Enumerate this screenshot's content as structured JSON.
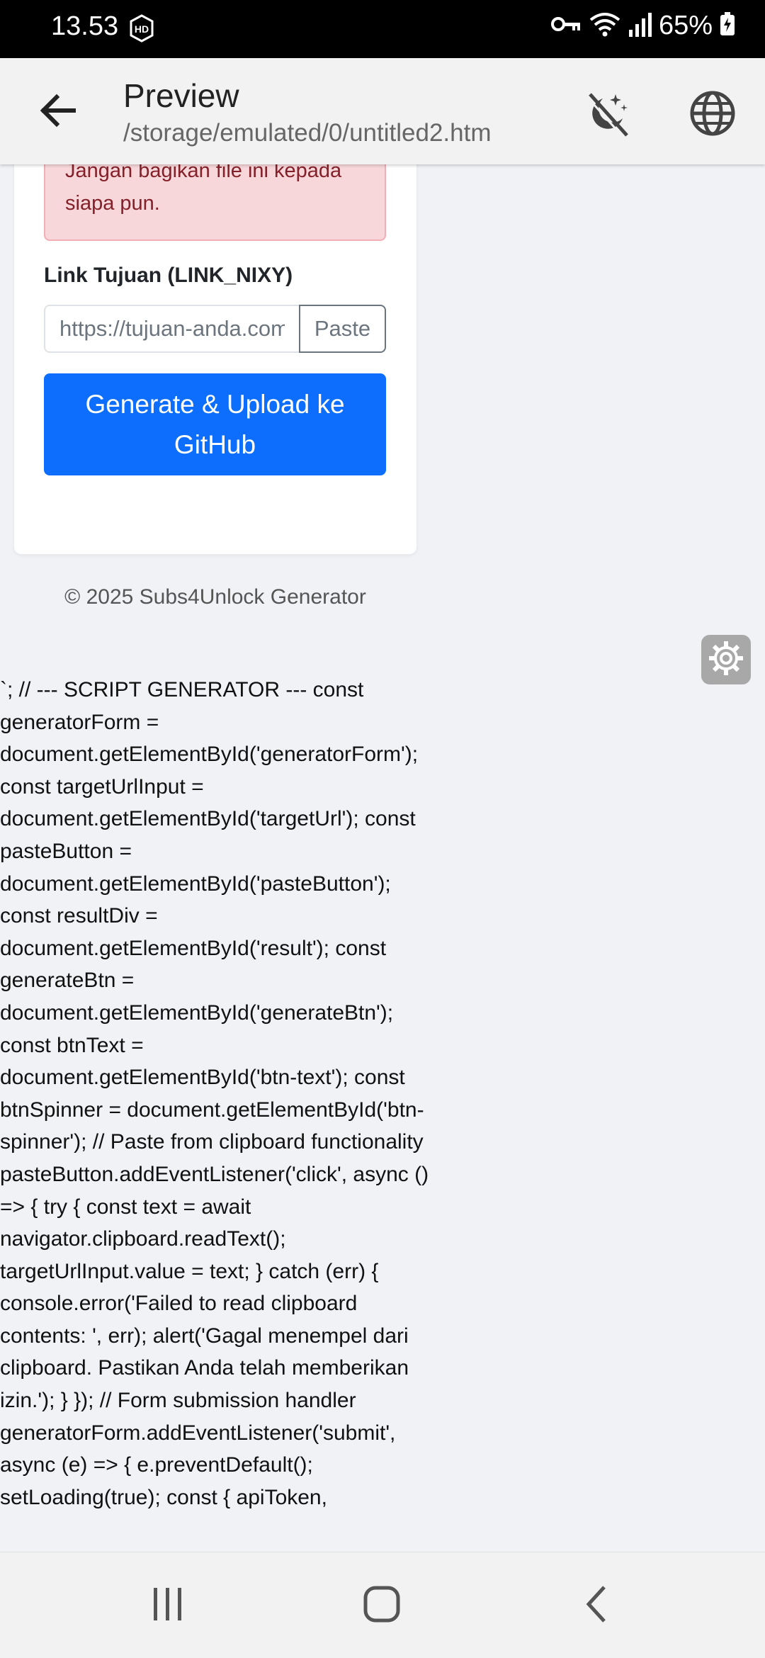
{
  "status_bar": {
    "time": "13.53",
    "battery_text": "65%"
  },
  "app_bar": {
    "title": "Preview",
    "subtitle": "/storage/emulated/0/untitled2.htm"
  },
  "card": {
    "alert_text": "Jangan bagikan file ini kepada siapa pun.",
    "target_label": "Link Tujuan (LINK_NIXY)",
    "target_placeholder": "https://tujuan-anda.com",
    "paste_label": "Paste",
    "generate_label": "Generate & Upload ke GitHub"
  },
  "footer": {
    "copyright": "© 2025 Subs4Unlock Generator"
  },
  "raw_script_text": "`; // --- SCRIPT GENERATOR --- const generatorForm = document.getElementById('generatorForm'); const targetUrlInput = document.getElementById('targetUrl'); const pasteButton = document.getElementById('pasteButton'); const resultDiv = document.getElementById('result'); const generateBtn = document.getElementById('generateBtn'); const btnText = document.getElementById('btn-text'); const btnSpinner = document.getElementById('btn-spinner'); // Paste from clipboard functionality pasteButton.addEventListener('click', async () => { try { const text = await navigator.clipboard.readText(); targetUrlInput.value = text; } catch (err) { console.error('Failed to read clipboard contents: ', err); alert('Gagal menempel dari clipboard. Pastikan Anda telah memberikan izin.'); } }); // Form submission handler generatorForm.addEventListener('submit', async (e) => { e.preventDefault(); setLoading(true); const { apiToken,",
  "icons": {
    "status_hd": "hd-icon",
    "status_key": "key-icon",
    "status_wifi": "wifi-icon",
    "status_signal": "signal-icon",
    "status_battery": "battery-charging-icon",
    "back": "arrow-back-icon",
    "theme": "theme-toggle-icon",
    "globe": "globe-icon",
    "float": "settings-gear-icon"
  },
  "colors": {
    "primary": "#0d6efd",
    "alert_bg": "#f8d7da",
    "alert_text": "#842029",
    "page_bg": "#f0f2f6"
  }
}
